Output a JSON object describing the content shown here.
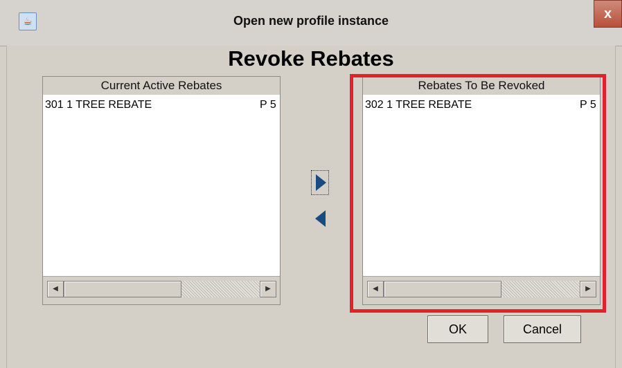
{
  "window": {
    "title": "Open new profile instance",
    "close_label": "x",
    "app_icon": "java-cup-icon"
  },
  "dialog": {
    "heading": "Revoke Rebates"
  },
  "left_list": {
    "header": "Current Active Rebates",
    "items": [
      {
        "text": "301 1 TREE REBATE",
        "trail": "P 5"
      }
    ]
  },
  "right_list": {
    "header": "Rebates To Be Revoked",
    "items": [
      {
        "text": "302 1 TREE REBATE",
        "trail": "P 5"
      }
    ]
  },
  "transfer": {
    "move_right_icon": "arrow-right-icon",
    "move_left_icon": "arrow-left-icon"
  },
  "buttons": {
    "ok": "OK",
    "cancel": "Cancel"
  },
  "colors": {
    "highlight": "#e4202a",
    "arrow": "#1a4a82",
    "background": "#d4d0c8"
  }
}
